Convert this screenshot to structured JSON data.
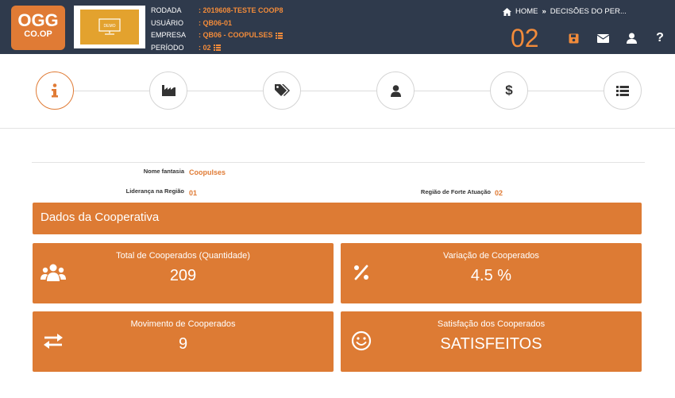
{
  "header": {
    "logo": {
      "main": "OGG",
      "sub": "CO.OP"
    },
    "demo_label": "DEMO",
    "info": [
      {
        "label": "RODADA",
        "value": ": 2019608-TESTE COOP8",
        "has_list_icon": false
      },
      {
        "label": "USUÁRIO",
        "value": ": QB06-01",
        "has_list_icon": false
      },
      {
        "label": "EMPRESA",
        "value": ": QB06 - COOPULSES",
        "has_list_icon": true
      },
      {
        "label": "PERÍODO",
        "value": ": 02",
        "has_list_icon": true
      }
    ],
    "breadcrumb": {
      "home": "HOME",
      "separator": "»",
      "current": "DECISÕES DO PER..."
    },
    "round_number": "02",
    "icons": [
      "save-icon",
      "mail-icon",
      "user-icon",
      "help-icon"
    ],
    "help_label": "?"
  },
  "steps": [
    {
      "icon": "info-icon",
      "active": true
    },
    {
      "icon": "factory-icon",
      "active": false
    },
    {
      "icon": "tags-icon",
      "active": false
    },
    {
      "icon": "user-icon",
      "active": false
    },
    {
      "icon": "dollar-icon",
      "active": false
    },
    {
      "icon": "list-icon",
      "active": false
    }
  ],
  "fields": {
    "nome_fantasia": {
      "label": "Nome fantasia",
      "value": "Coopulses"
    },
    "lideranca": {
      "label": "Liderança na Região",
      "value": "01"
    },
    "regiao_forte": {
      "label": "Região de Forte Atuação",
      "value": "02"
    }
  },
  "section_title": "Dados da Cooperativa",
  "cards": [
    {
      "title": "Total de Cooperados (Quantidade)",
      "value": "209",
      "icon": "users-icon"
    },
    {
      "title": "Variação de Cooperados",
      "value": "4.5 %",
      "icon": "percent-icon"
    },
    {
      "title": "Movimento de Cooperados",
      "value": "9",
      "icon": "exchange-icon"
    },
    {
      "title": "Satisfação dos Cooperados",
      "value": "SATISFEITOS",
      "icon": "smile-icon"
    }
  ],
  "colors": {
    "header_bg": "#2f3a4c",
    "accent": "#e07b35",
    "header_value": "#f28b3a",
    "demo_bg": "#e3a22e"
  }
}
